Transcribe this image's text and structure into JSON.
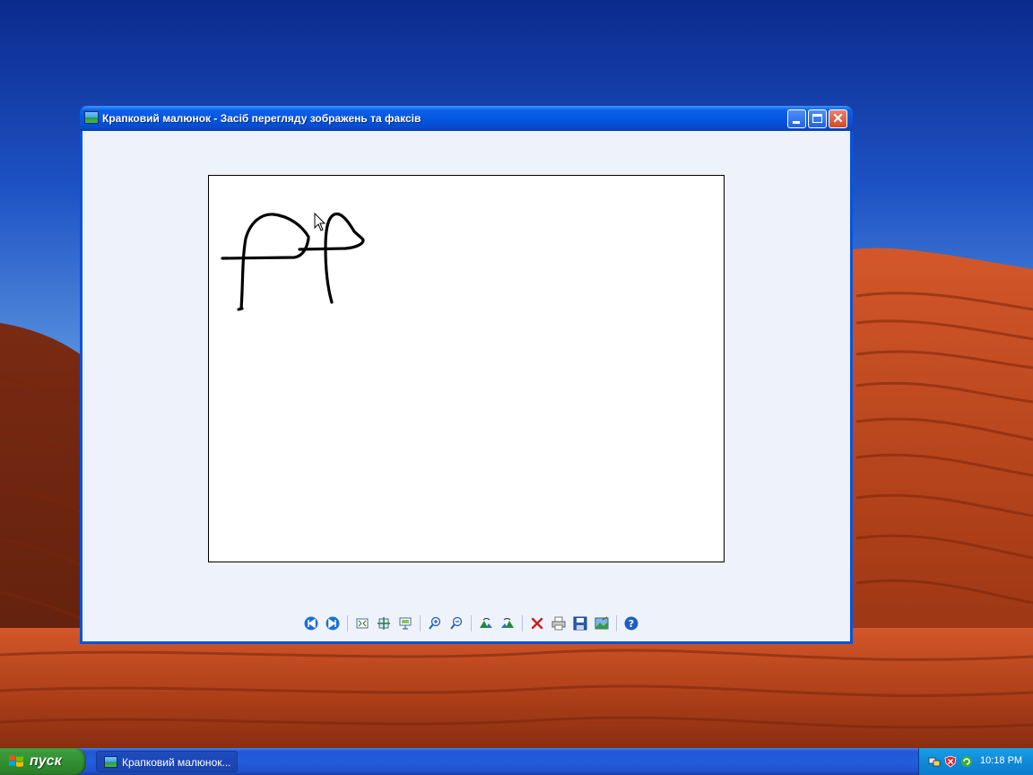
{
  "window": {
    "title": "Крапковий малюнок - Засіб перегляду зображень та факсів"
  },
  "toolbar": {
    "items": [
      {
        "name": "previous-image-button",
        "icon": "previous-icon"
      },
      {
        "name": "next-image-button",
        "icon": "next-icon"
      },
      {
        "name": "best-fit-button",
        "icon": "best-fit-icon"
      },
      {
        "name": "actual-size-button",
        "icon": "actual-size-icon"
      },
      {
        "name": "slideshow-button",
        "icon": "slideshow-icon"
      },
      {
        "name": "zoom-in-button",
        "icon": "zoom-in-icon"
      },
      {
        "name": "zoom-out-button",
        "icon": "zoom-out-icon"
      },
      {
        "name": "rotate-clockwise-button",
        "icon": "rotate-clockwise-icon"
      },
      {
        "name": "rotate-counterclockwise-button",
        "icon": "rotate-counterclockwise-icon"
      },
      {
        "name": "delete-button",
        "icon": "delete-icon"
      },
      {
        "name": "print-button",
        "icon": "print-icon"
      },
      {
        "name": "save-button",
        "icon": "save-icon"
      },
      {
        "name": "edit-button",
        "icon": "edit-icon"
      },
      {
        "name": "help-button",
        "icon": "help-icon"
      }
    ]
  },
  "taskbar": {
    "start_label": "пуск",
    "task_label": "Крапковий малюнок...",
    "clock": "10:18 PM"
  },
  "colors": {
    "titlebar": "#0554e0",
    "client_background": "#eef3fb",
    "taskbar": "#245edb",
    "start_button": "#2f8d2f",
    "tray": "#0f8ad9"
  }
}
